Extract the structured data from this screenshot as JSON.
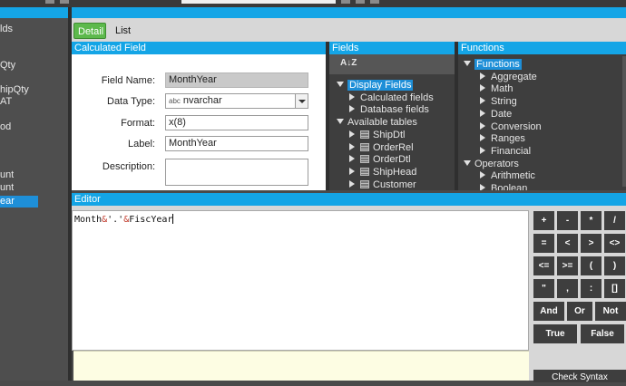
{
  "tabs": [
    {
      "label": "Detail",
      "active": true
    },
    {
      "label": "List",
      "active": false
    }
  ],
  "left_panel": {
    "items": [
      "lds",
      "",
      "Qty",
      "",
      "hipQty",
      "AT",
      "",
      "od",
      "",
      "unt",
      "unt",
      "ear"
    ],
    "selected_index": 11
  },
  "calculated_field": {
    "header": "Calculated Field",
    "field_name": {
      "label": "Field Name:",
      "value": "MonthYear"
    },
    "data_type": {
      "label": "Data Type:",
      "type_prefix": "abc",
      "value": "nvarchar"
    },
    "format": {
      "label": "Format:",
      "value": "x(8)"
    },
    "label_field": {
      "label": "Label:",
      "value": "MonthYear"
    },
    "description": {
      "label": "Description:",
      "value": ""
    }
  },
  "fields_panel": {
    "header": "Fields",
    "sort_glyph": "A↓Z",
    "tree": [
      {
        "label": "Display Fields",
        "level": 0,
        "expanded": true,
        "selected": true
      },
      {
        "label": "Calculated fields",
        "level": 1,
        "expanded": false
      },
      {
        "label": "Database fields",
        "level": 1,
        "expanded": false
      },
      {
        "label": "Available tables",
        "level": 0,
        "expanded": true
      },
      {
        "label": "ShipDtl",
        "level": 1,
        "table": true
      },
      {
        "label": "OrderRel",
        "level": 1,
        "table": true
      },
      {
        "label": "OrderDtl",
        "level": 1,
        "table": true
      },
      {
        "label": "ShipHead",
        "level": 1,
        "table": true
      },
      {
        "label": "Customer",
        "level": 1,
        "table": true
      }
    ]
  },
  "functions_panel": {
    "header": "Functions",
    "tree": [
      {
        "label": "Functions",
        "level": 0,
        "expanded": true,
        "selected": true
      },
      {
        "label": "Aggregate",
        "level": 1
      },
      {
        "label": "Math",
        "level": 1
      },
      {
        "label": "String",
        "level": 1
      },
      {
        "label": "Date",
        "level": 1
      },
      {
        "label": "Conversion",
        "level": 1
      },
      {
        "label": "Ranges",
        "level": 1
      },
      {
        "label": "Financial",
        "level": 1
      },
      {
        "label": "Operators",
        "level": 0,
        "expanded": true
      },
      {
        "label": "Arithmetic",
        "level": 1
      },
      {
        "label": "Boolean",
        "level": 1
      }
    ]
  },
  "editor": {
    "header": "Editor",
    "expr_part1": "Month",
    "expr_amp1": "&",
    "expr_part2": "'.'",
    "expr_amp2": "&",
    "expr_part3": "FiscYear"
  },
  "keypad": {
    "rows": [
      [
        "+",
        "-",
        "*",
        "/"
      ],
      [
        "=",
        "<",
        ">",
        "<>"
      ],
      [
        "<=",
        ">=",
        "(",
        ")"
      ],
      [
        "\"",
        ",",
        ":",
        "[]"
      ]
    ],
    "logic": [
      "And",
      "Or",
      "Not"
    ],
    "bool": [
      "True",
      "False"
    ],
    "check_syntax": "Check Syntax"
  }
}
